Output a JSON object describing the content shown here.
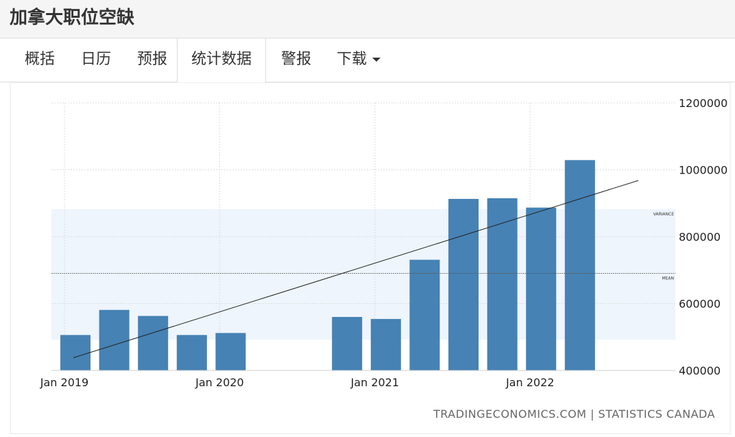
{
  "header": {
    "title": "加拿大职位空缺"
  },
  "tabs": [
    {
      "label": "概括"
    },
    {
      "label": "日历"
    },
    {
      "label": "预报"
    },
    {
      "label": "统计数据",
      "active": true
    },
    {
      "label": "警报"
    },
    {
      "label": "下载"
    }
  ],
  "colors": {
    "bar": "#4682b4",
    "band": "#eef5fc",
    "trend": "#222222"
  },
  "chart_data": {
    "type": "bar",
    "title": "",
    "xlabel": "",
    "ylabel": "",
    "x": [
      "2019-Q1",
      "2019-Q2",
      "2019-Q3",
      "2019-Q4",
      "2020-Q1",
      "2020-Q2",
      "2020-Q3",
      "2021-Q1",
      "2021-Q2",
      "2021-Q3",
      "2021-Q4",
      "2022-Q1",
      "2022-Q2",
      "2022-Q3"
    ],
    "values": [
      506000,
      581000,
      563000,
      506000,
      512000,
      null,
      null,
      560000,
      554000,
      731000,
      913000,
      915000,
      887000,
      1029000
    ],
    "x_tick_labels": [
      "Jan 2019",
      "Jan 2020",
      "Jan 2021",
      "Jan 2022"
    ],
    "y_tick_labels": [
      "1200000",
      "1000000",
      "800000",
      "600000",
      "400000"
    ],
    "ylim": [
      400000,
      1200000
    ],
    "y_axis_position": "right",
    "grid": true,
    "mean": {
      "label": "MEAN",
      "value": 690000
    },
    "variance": {
      "label": "VARIANCE",
      "range": [
        492000,
        882000
      ]
    },
    "trend_line": [
      438000,
      968000
    ],
    "source": "TRADINGECONOMICS.COM | STATISTICS CANADA"
  }
}
